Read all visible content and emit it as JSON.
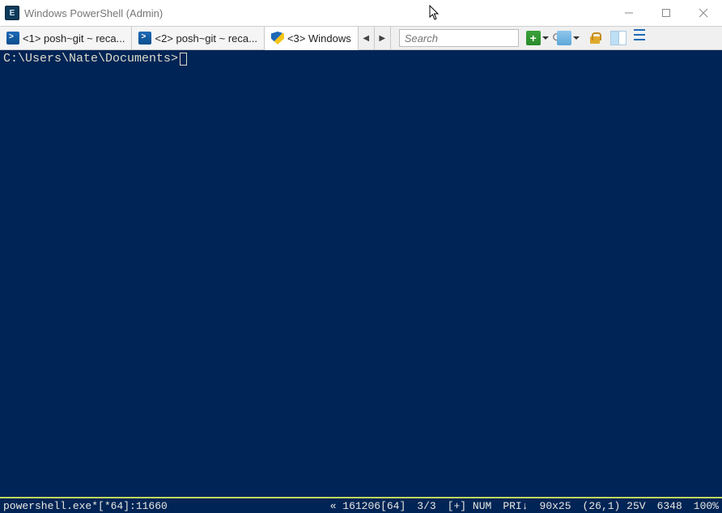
{
  "window": {
    "title": "Windows PowerShell (Admin)"
  },
  "tabs": [
    {
      "label": "<1> posh~git ~ reca...",
      "icon": "powershell",
      "active": false
    },
    {
      "label": "<2> posh~git ~ reca...",
      "icon": "powershell",
      "active": false
    },
    {
      "label": "<3> Windows",
      "icon": "shield",
      "active": true
    }
  ],
  "search": {
    "placeholder": "Search",
    "value": ""
  },
  "terminal": {
    "prompt": "C:\\Users\\Nate\\Documents>"
  },
  "status": {
    "process": "powershell.exe*[*64]:11660",
    "build": "« 161206[64]",
    "counter": "3/3",
    "mode": "[+] NUM",
    "priority": "PRI↓",
    "size": "90x25",
    "cursor": "(26,1) 25V",
    "pid": "6348",
    "zoom": "100%"
  }
}
